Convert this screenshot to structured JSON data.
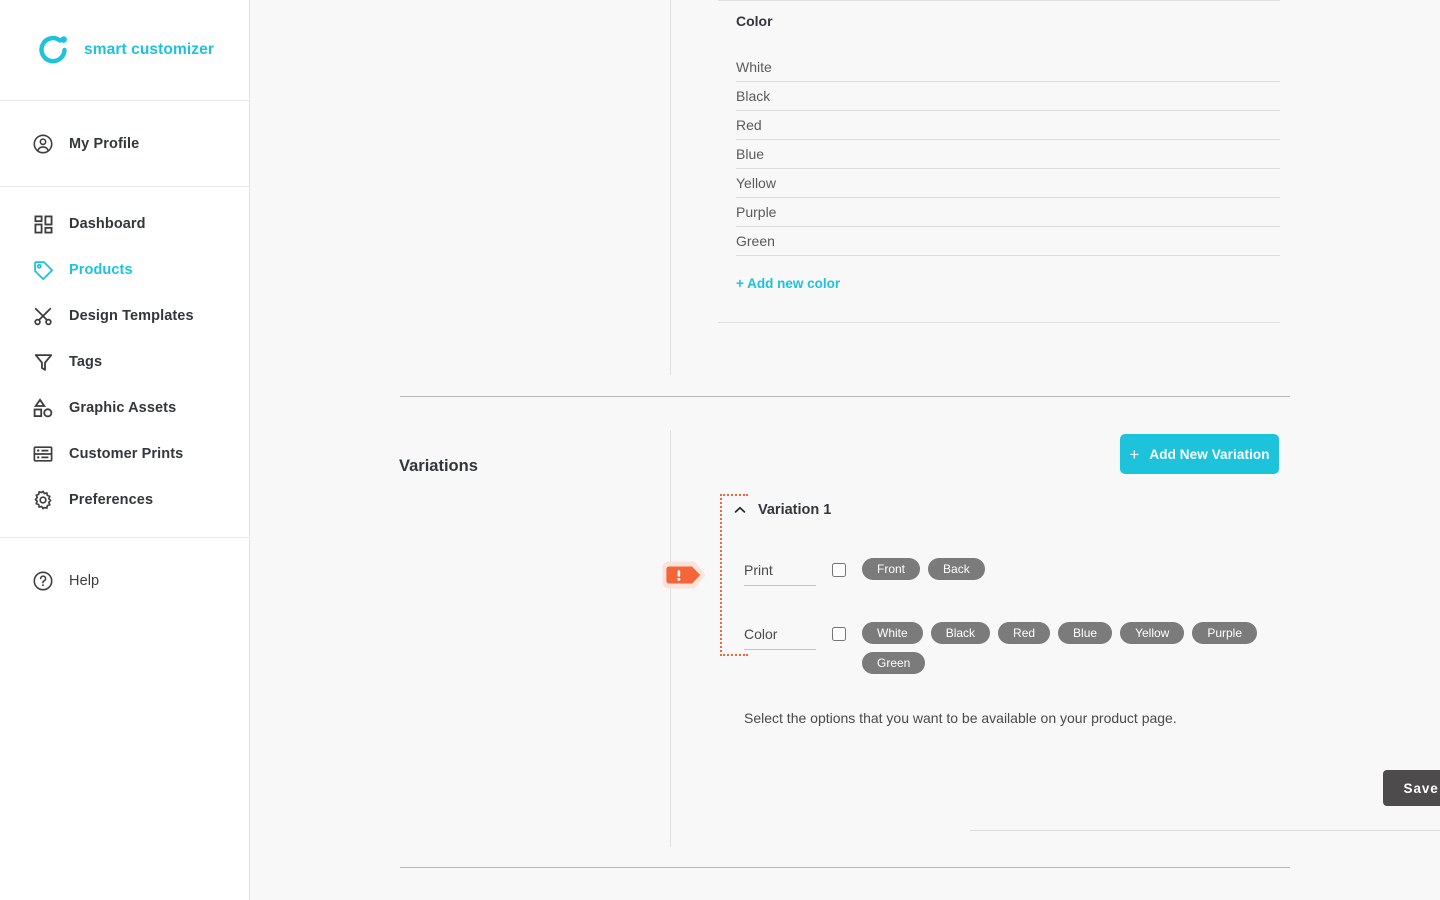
{
  "brand": {
    "name": "smart customizer",
    "logo_icon": "ring-dot-logo-icon",
    "accent_color": "#1cc3da"
  },
  "sidebar": {
    "profile": {
      "label": "My Profile",
      "icon": "user-circle-icon"
    },
    "items": [
      {
        "label": "Dashboard",
        "icon": "dashboard-grid-icon",
        "active": false
      },
      {
        "label": "Products",
        "icon": "tag-icon",
        "active": true
      },
      {
        "label": "Design Templates",
        "icon": "scissors-pen-icon",
        "active": false
      },
      {
        "label": "Tags",
        "icon": "funnel-icon",
        "active": false
      },
      {
        "label": "Graphic Assets",
        "icon": "shapes-icon",
        "active": false
      },
      {
        "label": "Customer Prints",
        "icon": "print-rows-icon",
        "active": false
      },
      {
        "label": "Preferences",
        "icon": "gear-icon",
        "active": false
      }
    ],
    "help": {
      "label": "Help",
      "icon": "question-circle-icon"
    }
  },
  "color_section": {
    "title": "Color",
    "values": [
      "White",
      "Black",
      "Red",
      "Blue",
      "Yellow",
      "Purple",
      "Green"
    ],
    "add_link": "+ Add new color"
  },
  "variations": {
    "title": "Variations",
    "add_button": "Add New Variation",
    "add_button_icon": "plus-icon",
    "warning_icon": "exclamation-marker-icon",
    "variation": {
      "name": "Variation 1",
      "collapse_icon": "chevron-up-icon",
      "options": [
        {
          "label": "Print",
          "checked": false,
          "tags": [
            "Front",
            "Back"
          ]
        },
        {
          "label": "Color",
          "checked": false,
          "tags": [
            "White",
            "Black",
            "Red",
            "Blue",
            "Yellow",
            "Purple",
            "Green"
          ]
        }
      ],
      "helper_text": "Select the options that you want to be available on your product page.",
      "save_button": "Save Variation"
    }
  },
  "chat": {
    "icon": "envelope-chat-icon",
    "color": "#1cc3da"
  },
  "colors": {
    "accent": "#1cc3da",
    "warning": "#f4653a",
    "pill": "#7b7b7b",
    "dark_button": "#4d4b4b",
    "text": "#33363b",
    "page_bg": "#f8f8f8"
  }
}
